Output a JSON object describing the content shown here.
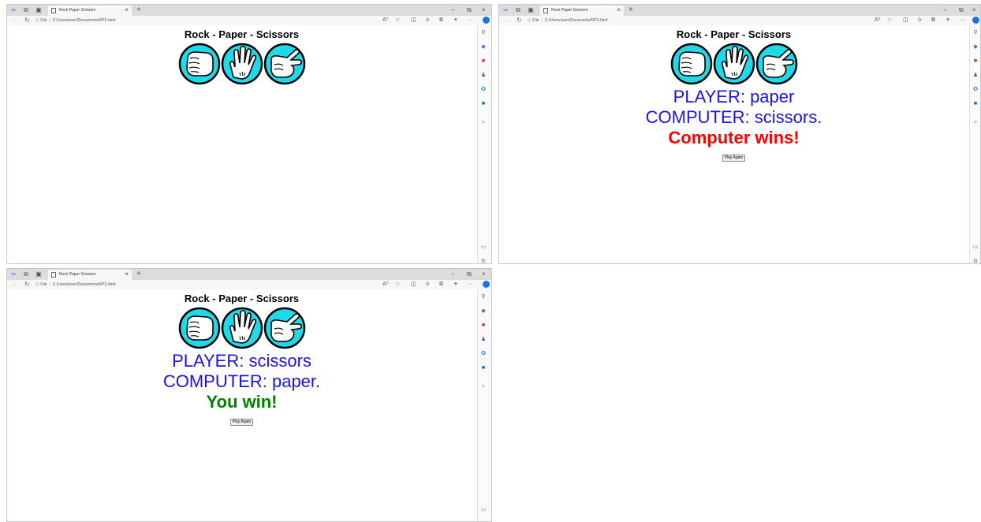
{
  "browser": {
    "tab_title": "Rock Paper Scissors",
    "url_label": "File",
    "url": "C:/Users/user/Documents/RPS.html",
    "tab_close": "×",
    "new_tab": "+",
    "minimize": "–",
    "restore": "⧉",
    "close": "×",
    "more": "···",
    "sidebar_add": "+"
  },
  "game": {
    "heading": "Rock - Paper - Scissors",
    "choices": [
      "rock",
      "paper",
      "scissors"
    ]
  },
  "windows": [
    {
      "player_text": "",
      "computer_text": "",
      "result_text": "",
      "button_label": ""
    },
    {
      "player_text": "PLAYER: paper",
      "computer_text": "COMPUTER: scissors.",
      "result_text": "Computer wins!",
      "result_color": "#ff0000",
      "button_label": "Play Again"
    },
    {
      "player_text": "PLAYER: scissors",
      "computer_text": "COMPUTER: paper.",
      "result_text": "You win!",
      "result_color": "#008000",
      "button_label": "Play Again"
    }
  ],
  "colors": {
    "hand_circle": "#1fd8e8",
    "player_text": "#1a14e6",
    "lose": "#ff0000",
    "win": "#008000"
  }
}
